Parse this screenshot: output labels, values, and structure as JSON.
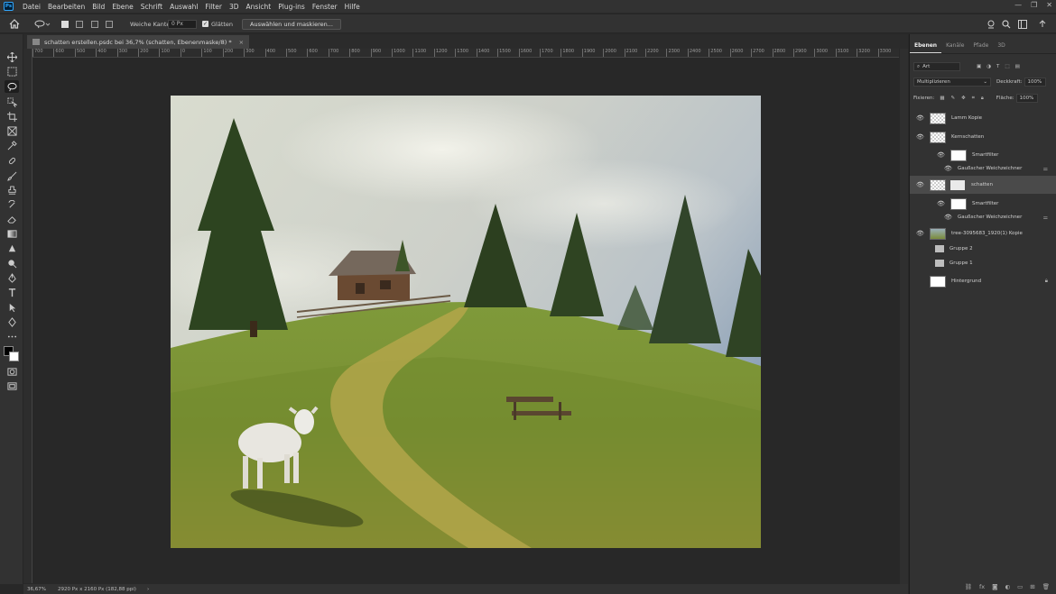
{
  "menu": {
    "logo": "Ps",
    "items": [
      "Datei",
      "Bearbeiten",
      "Bild",
      "Ebene",
      "Schrift",
      "Auswahl",
      "Filter",
      "3D",
      "Ansicht",
      "Plug-ins",
      "Fenster",
      "Hilfe"
    ],
    "window_controls": [
      "—",
      "❐",
      "✕"
    ]
  },
  "options": {
    "feather_label": "Weiche Kante:",
    "feather_value": "0 Px",
    "antialias_label": "Glätten",
    "select_mask_button": "Auswählen und maskieren..."
  },
  "document": {
    "tab_title": "schatten erstellen.psdc bei 36,7% (schatten, Ebenenmaske/8) *",
    "close": "×"
  },
  "ruler": {
    "labels": [
      "700",
      "600",
      "500",
      "400",
      "300",
      "200",
      "100",
      "0",
      "100",
      "200",
      "300",
      "400",
      "500",
      "600",
      "700",
      "800",
      "900",
      "1000",
      "1100",
      "1200",
      "1300",
      "1400",
      "1500",
      "1600",
      "1700",
      "1800",
      "1900",
      "2000",
      "2100",
      "2200",
      "2300",
      "2400",
      "2500",
      "2600",
      "2700",
      "2800",
      "2900",
      "3000",
      "3100",
      "3200",
      "3300"
    ]
  },
  "status": {
    "zoom": "36,67%",
    "dimensions": "2920 Px x 2160 Px (182,88 ppi)",
    "arrow": "›"
  },
  "panel": {
    "tabs": [
      "Ebenen",
      "Kanäle",
      "Pfade",
      "3D"
    ],
    "filter_type": "Art",
    "blend_mode": "Multiplizieren",
    "opacity_label": "Deckkraft:",
    "opacity_value": "100%",
    "lock_label": "Fixieren:",
    "fill_label": "Fläche:",
    "fill_value": "100%",
    "layers": [
      {
        "name": "Lamm Kopie",
        "thumb": "checker"
      },
      {
        "name": "Kernschatten",
        "thumb": "smart"
      },
      {
        "name": "Smartfilter",
        "thumb": "white",
        "sub": true
      },
      {
        "name": "Gaußscher Weichzeichner",
        "thumb": "none",
        "sub": true
      },
      {
        "name": "schatten",
        "thumb": "mask",
        "selected": true
      },
      {
        "name": "Smartfilter",
        "thumb": "white",
        "sub": true
      },
      {
        "name": "Gaußscher Weichzeichner",
        "thumb": "none",
        "sub": true
      },
      {
        "name": "tree-3095683_1920(1) Kopie",
        "thumb": "photo"
      },
      {
        "name": "Gruppe 2",
        "thumb": "folder"
      },
      {
        "name": "Gruppe 1",
        "thumb": "folder"
      },
      {
        "name": "Hintergrund",
        "thumb": "white"
      }
    ]
  },
  "colors": {
    "accent": "#31a8ff",
    "ui_bg": "#323232",
    "canvas_bg": "#282828",
    "selected_layer": "#4a4a4a"
  }
}
